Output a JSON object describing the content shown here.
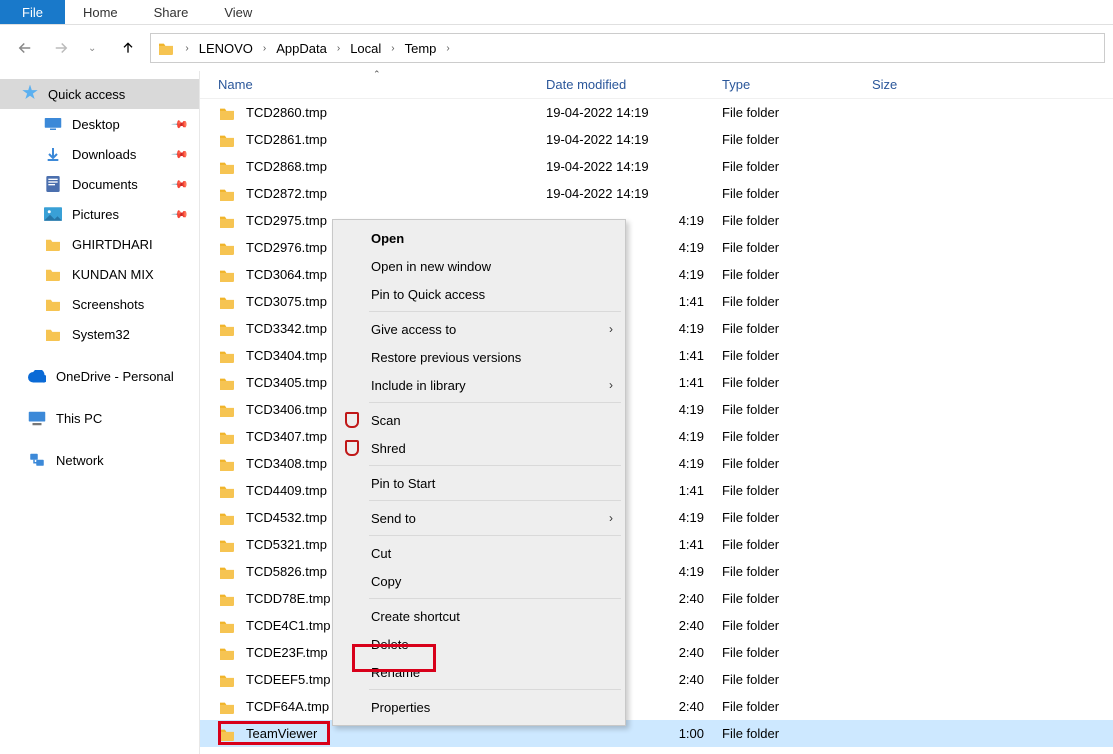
{
  "ribbon": {
    "file": "File",
    "home": "Home",
    "share": "Share",
    "view": "View"
  },
  "breadcrumb": {
    "items": [
      "LENOVO",
      "AppData",
      "Local",
      "Temp"
    ]
  },
  "sidebar": {
    "quick": "Quick access",
    "desktop": "Desktop",
    "downloads": "Downloads",
    "documents": "Documents",
    "pictures": "Pictures",
    "ghr": "GHIRTDHARI",
    "kundan": "KUNDAN MIX",
    "screenshots": "Screenshots",
    "sys32": "System32",
    "onedrive": "OneDrive - Personal",
    "thispc": "This PC",
    "network": "Network"
  },
  "columns": {
    "name": "Name",
    "date": "Date modified",
    "type": "Type",
    "size": "Size"
  },
  "fileType": "File folder",
  "files": [
    {
      "name": "TCD2860.tmp",
      "date": "19-04-2022 14:19"
    },
    {
      "name": "TCD2861.tmp",
      "date": "19-04-2022 14:19"
    },
    {
      "name": "TCD2868.tmp",
      "date": "19-04-2022 14:19"
    },
    {
      "name": "TCD2872.tmp",
      "date": "19-04-2022 14:19"
    },
    {
      "name": "TCD2975.tmp",
      "date": "4:19"
    },
    {
      "name": "TCD2976.tmp",
      "date": "4:19"
    },
    {
      "name": "TCD3064.tmp",
      "date": "4:19"
    },
    {
      "name": "TCD3075.tmp",
      "date": "1:41"
    },
    {
      "name": "TCD3342.tmp",
      "date": "4:19"
    },
    {
      "name": "TCD3404.tmp",
      "date": "1:41"
    },
    {
      "name": "TCD3405.tmp",
      "date": "1:41"
    },
    {
      "name": "TCD3406.tmp",
      "date": "4:19"
    },
    {
      "name": "TCD3407.tmp",
      "date": "4:19"
    },
    {
      "name": "TCD3408.tmp",
      "date": "4:19"
    },
    {
      "name": "TCD4409.tmp",
      "date": "1:41"
    },
    {
      "name": "TCD4532.tmp",
      "date": "4:19"
    },
    {
      "name": "TCD5321.tmp",
      "date": "1:41"
    },
    {
      "name": "TCD5826.tmp",
      "date": "4:19"
    },
    {
      "name": "TCDD78E.tmp",
      "date": "2:40"
    },
    {
      "name": "TCDE4C1.tmp",
      "date": "2:40"
    },
    {
      "name": "TCDE23F.tmp",
      "date": "2:40"
    },
    {
      "name": "TCDEEF5.tmp",
      "date": "2:40"
    },
    {
      "name": "TCDF64A.tmp",
      "date": "2:40"
    },
    {
      "name": "TeamViewer",
      "date": "1:00"
    }
  ],
  "ctx": {
    "open": "Open",
    "newwin": "Open in new window",
    "pinquick": "Pin to Quick access",
    "giveaccess": "Give access to",
    "restore": "Restore previous versions",
    "include": "Include in library",
    "scan": "Scan",
    "shred": "Shred",
    "pinstart": "Pin to Start",
    "sendto": "Send to",
    "cut": "Cut",
    "copy": "Copy",
    "shortcut": "Create shortcut",
    "delete": "Delete",
    "rename": "Rename",
    "properties": "Properties"
  }
}
